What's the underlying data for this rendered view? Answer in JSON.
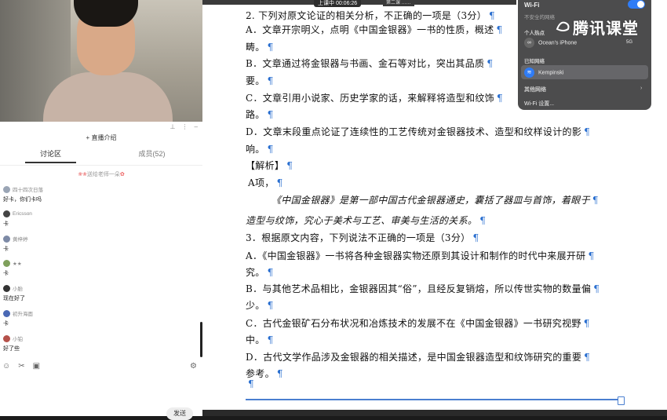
{
  "recording": {
    "label": "上课中 00:06:26"
  },
  "tab_title": "第二课 ……",
  "chat": {
    "live_intro": "+ 直播介绍",
    "tabs": [
      {
        "label": "讨论区"
      },
      {
        "label": "成员(52)"
      }
    ],
    "gift": "送给老师一朵",
    "messages": [
      {
        "user": "四十四次日落",
        "text": "好卡，你们卡吗",
        "color": "#9aa5b5"
      },
      {
        "user": "Ericsson",
        "text": "卡",
        "color": "#444444"
      },
      {
        "user": "黄梓婷",
        "text": "卡",
        "color": "#7d8aa6"
      },
      {
        "user": "★★",
        "text": "卡",
        "color": "#7fa05c"
      },
      {
        "user": "小胎",
        "text": "现在好了",
        "color": "#333333"
      },
      {
        "user": "初升海面",
        "text": "卡",
        "color": "#4a69b5"
      },
      {
        "user": "小铂",
        "text": "好了些",
        "color": "#b5514a"
      }
    ],
    "send_label": "发送"
  },
  "doc": {
    "lines": [
      {
        "text": "2.  下列对原文论证的相关分析，不正确的一项是（3分）"
      },
      {
        "text": "A．文章开宗明义，点明《中国金银器》一书的性质，概述"
      },
      {
        "text": "畴。"
      },
      {
        "text": "B．文章通过将金银器与书画、金石等对比，突出其品质"
      },
      {
        "text": "要。"
      },
      {
        "text": "C．文章引用小说家、历史学家的话，来解释将造型和纹饰"
      },
      {
        "text": "路。"
      },
      {
        "text": "D．文章末段重点论证了连续性的工艺传统对金银器技术、造型和纹样设计的影"
      },
      {
        "text": "响。"
      },
      {
        "text": "【解析】"
      },
      {
        "text": "A项，"
      },
      {
        "text": "《中国金银器》是第一部中国古代金银器通史，囊括了器皿与首饰，着眼于"
      },
      {
        "text": "造型与纹饰，究心于美术与工艺、审美与生活的关系。"
      },
      {
        "text": "3．根据原文内容，下列说法不正确的一项是（3分）"
      },
      {
        "text": "A．《中国金银器》一书将各种金银器实物还原到其设计和制作的时代中来展开研"
      },
      {
        "text": "究。"
      },
      {
        "text": "B．与其他艺术品相比，金银器因其“俗”，且经反复销熔，所以传世实物的数量偏"
      },
      {
        "text": "少。"
      },
      {
        "text": "C．古代金银矿石分布状况和冶炼技术的发展不在《中国金银器》一书研究视野"
      },
      {
        "text": "中。"
      },
      {
        "text": "D．古代文学作品涉及金银器的相关描述，是中国金银器造型和纹饰研究的重要"
      },
      {
        "text": "参考。"
      }
    ],
    "pilcrow": "¶"
  },
  "wifi": {
    "title": "Wi-Fi",
    "insecure": "不安全的网络",
    "hotspot_header": "个人热点",
    "hotspot_name": "Ocean's iPhone",
    "hotspot_signal": "5G",
    "known_header": "已知网络",
    "known_name": "Kempinski",
    "other_header": "其他网络",
    "settings": "Wi-Fi 设置..."
  },
  "brand": {
    "text": "腾讯课堂"
  }
}
